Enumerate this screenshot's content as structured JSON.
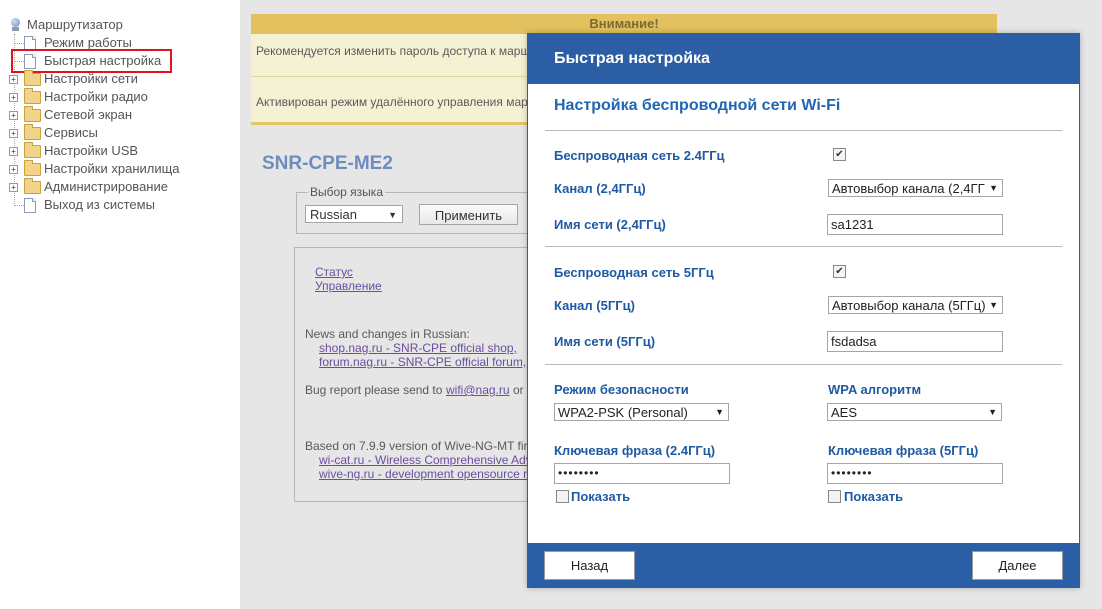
{
  "sidebar": {
    "root_label": "Маршрутизатор",
    "items": [
      {
        "label": "Режим работы",
        "kind": "page"
      },
      {
        "label": "Быстрая настройка",
        "kind": "page",
        "selected": true
      },
      {
        "label": "Настройки сети",
        "kind": "folder"
      },
      {
        "label": "Настройки радио",
        "kind": "folder"
      },
      {
        "label": "Сетевой экран",
        "kind": "folder"
      },
      {
        "label": "Сервисы",
        "kind": "folder"
      },
      {
        "label": "Настройки USB",
        "kind": "folder"
      },
      {
        "label": "Настройки хранилища",
        "kind": "folder"
      },
      {
        "label": "Администрирование",
        "kind": "folder"
      },
      {
        "label": "Выход из системы",
        "kind": "page"
      }
    ]
  },
  "warning": {
    "title": "Внимание!",
    "line1": "Рекомендуется изменить пароль доступа к марш",
    "line2": "Активирован режим удалённого управления мар"
  },
  "main": {
    "device_title": "SNR-CPE-ME2",
    "lang_legend": "Выбор языка",
    "lang_value": "Russian",
    "apply_label": "Применить",
    "links": {
      "status": "Статус",
      "control": "Управление"
    },
    "news_text": "News and changes in Russian:",
    "news_link1": "shop.nag.ru - SNR-CPE official shop,",
    "news_link2": "forum.nag.ru - SNR-CPE official forum,",
    "bug_text": "Bug report please send to",
    "bug_link": "wifi@nag.ru",
    "bug_tail": "or",
    "based_text": "Based on 7.9.9 version of Wive-NG-MT fir",
    "based_link1": "wi-cat.ru - Wireless Comprehensive Adv",
    "based_link2": "wive-ng.ru - development opensource r"
  },
  "modal": {
    "title": "Быстрая настройка",
    "section_title": "Настройка беспроводной сети Wi-Fi",
    "wifi24_label": "Беспроводная сеть 2.4ГГц",
    "wifi24_checked": true,
    "channel24_label": "Канал (2,4ГГц)",
    "channel24_value": "Автовыбор канала (2,4ГГ",
    "ssid24_label": "Имя сети (2,4ГГц)",
    "ssid24_value": "sa1231",
    "wifi5_label": "Беспроводная сеть 5ГГц",
    "wifi5_checked": true,
    "channel5_label": "Канал (5ГГц)",
    "channel5_value": "Автовыбор канала (5ГГц)",
    "ssid5_label": "Имя сети (5ГГц)",
    "ssid5_value": "fsdadsa",
    "security_label": "Режим безопасности",
    "security_value": "WPA2-PSK (Personal)",
    "wpa_label": "WPA алгоритм",
    "wpa_value": "AES",
    "key24_label": "Ключевая фраза (2.4ГГц)",
    "key24_value": "••••••••",
    "key5_label": "Ключевая фраза (5ГГц)",
    "key5_value": "••••••••",
    "show_label": "Показать",
    "back_label": "Назад",
    "next_label": "Далее"
  },
  "colors": {
    "modal_blue": "#2c5ea6",
    "label_blue": "#1f5aa3",
    "warning_bar": "#e3c15f",
    "warning_bg": "#f5f1d3",
    "highlight_red": "#e0141e"
  }
}
